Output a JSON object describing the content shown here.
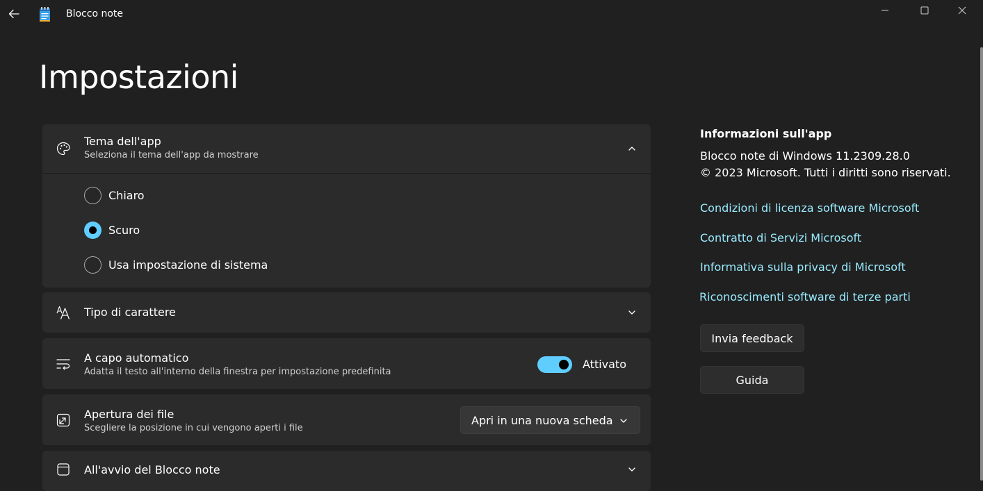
{
  "window": {
    "app_title": "Blocco note",
    "controls": [
      "minimize-icon",
      "maximize-icon",
      "close-icon"
    ]
  },
  "page": {
    "title": "Impostazioni"
  },
  "settings": {
    "theme": {
      "title": "Tema dell'app",
      "subtitle": "Seleziona il tema dell'app da mostrare",
      "icon": "palette-icon",
      "expanded": true,
      "options": [
        {
          "label": "Chiaro",
          "checked": false
        },
        {
          "label": "Scuro",
          "checked": true
        },
        {
          "label": "Usa impostazione di sistema",
          "checked": false
        }
      ]
    },
    "font": {
      "title": "Tipo di carattere",
      "icon": "font-icon"
    },
    "word_wrap": {
      "title": "A capo automatico",
      "subtitle": "Adatta il testo all'interno della finestra per impostazione predefinita",
      "icon": "text-wrap-icon",
      "toggle_on": true,
      "toggle_label": "Attivato"
    },
    "file_open": {
      "title": "Apertura dei file",
      "subtitle": "Scegliere la posizione in cui vengono aperti i file",
      "icon": "open-in-new-icon",
      "selected": "Apri in una nuova scheda"
    },
    "startup": {
      "title": "All'avvio del Blocco note",
      "icon": "window-icon"
    }
  },
  "about": {
    "title": "Informazioni sull'app",
    "version": "Blocco note di Windows 11.2309.28.0",
    "copyright": "© 2023 Microsoft. Tutti i diritti sono riservati.",
    "links": [
      "Condizioni di licenza software Microsoft",
      "Contratto di Servizi Microsoft",
      "Informativa sulla privacy di Microsoft",
      "Riconoscimenti software di terze parti"
    ],
    "feedback_button": "Invia feedback",
    "help_button": "Guida"
  },
  "colors": {
    "background": "#202020",
    "card": "#2b2b2b",
    "accent": "#60cdff",
    "link": "#99ebff"
  }
}
